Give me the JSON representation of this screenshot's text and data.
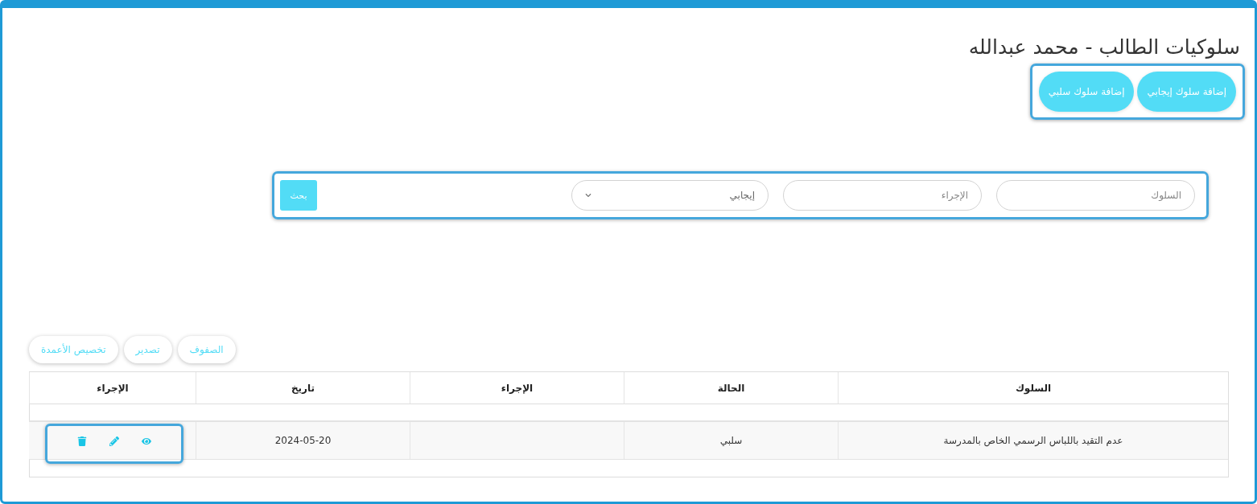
{
  "title": "سلوكيات الطالب - محمد عبدالله",
  "actions": [
    {
      "label": "إضافة سلوك إيجابي"
    },
    {
      "label": "إضافة سلوك سلبي"
    }
  ],
  "search": {
    "behavior_placeholder": "السلوك",
    "action_placeholder": "الإجراء",
    "status_value": "إيجابي",
    "button": "بحث"
  },
  "toolbar": [
    "الصفوف",
    "تصدير",
    "تخصيص الأعمدة"
  ],
  "table": {
    "columns": [
      "السلوك",
      "الحالة",
      "الإجراء",
      "تاريخ",
      "الإجراء"
    ],
    "rows": [
      {
        "behavior": "عدم التقيد باللباس الرسمي الخاص بالمدرسة",
        "status": "سلبي",
        "date": "2024-05-20"
      }
    ]
  }
}
